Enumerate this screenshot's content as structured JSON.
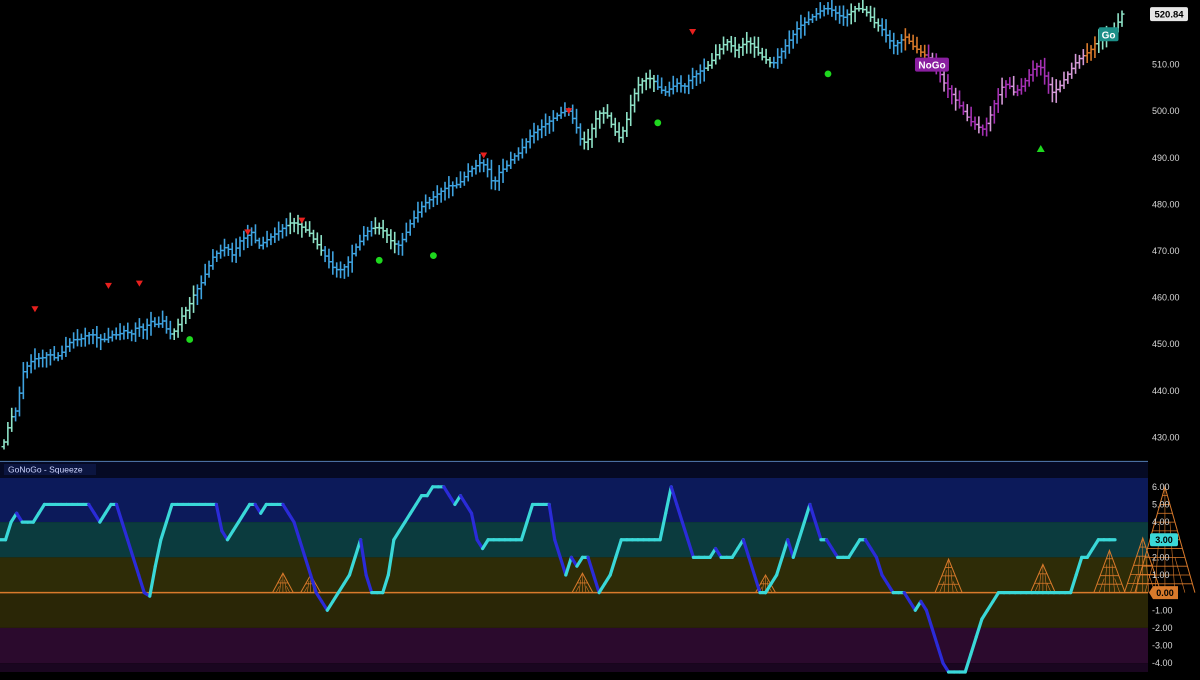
{
  "chart_data": [
    {
      "type": "ohlc",
      "title": "",
      "ylim": [
        426,
        523
      ],
      "yticks": [
        "430.00",
        "440.00",
        "450.00",
        "460.00",
        "470.00",
        "480.00",
        "490.00",
        "500.00",
        "510.00"
      ],
      "last_price_label": "520.84",
      "labels": {
        "nogo": "NoGo",
        "go": "Go"
      },
      "colors": {
        "strong_go": "#3fa3e0",
        "weak_go": "#8fe3c8",
        "nogo_weak": "#d59ad8",
        "nogo_strong": "#a531b4",
        "transition": "#d97a2b",
        "counter_down": "#e8201e",
        "go_dot": "#1ed81e",
        "nogo_badge": "#8a1fa0",
        "go_badge": "#1c8f88"
      },
      "price_series": [
        429,
        434,
        436,
        444,
        446,
        447,
        447,
        448,
        447,
        448,
        450,
        451,
        451,
        452,
        452,
        451,
        451,
        452,
        452,
        453,
        452,
        454,
        453,
        455,
        454,
        455,
        452,
        453,
        456,
        458,
        461,
        463,
        466,
        469,
        470,
        471,
        469,
        472,
        473,
        474,
        471,
        472,
        473,
        474,
        475,
        476,
        476,
        475,
        474,
        472,
        470,
        468,
        466,
        466,
        467,
        470,
        472,
        474,
        475,
        475,
        474,
        472,
        471,
        473,
        476,
        478,
        480,
        481,
        482,
        483,
        484,
        484,
        485,
        487,
        488,
        489,
        488,
        484,
        487,
        488,
        490,
        491,
        493,
        495,
        496,
        497,
        498,
        499,
        500,
        500,
        497,
        493,
        494,
        498,
        500,
        499,
        496,
        494,
        498,
        503,
        506,
        507,
        507,
        505,
        504,
        505,
        506,
        505,
        507,
        508,
        509,
        510,
        512,
        514,
        515,
        513,
        514,
        515,
        514,
        512,
        511,
        510,
        512,
        514,
        516,
        518,
        519,
        520,
        521,
        522,
        522,
        521,
        520,
        521,
        522,
        522,
        521,
        519,
        518,
        516,
        514,
        515,
        516,
        514,
        513,
        512,
        511,
        509,
        506,
        504,
        502,
        500,
        498,
        497,
        496,
        498,
        502,
        505,
        506,
        504,
        505,
        507,
        509,
        510,
        507,
        504,
        505,
        507,
        509,
        511,
        512,
        513,
        515,
        516,
        517,
        518,
        520.84
      ],
      "counter_trend_down": [
        {
          "i": 8,
          "v": 457.5
        },
        {
          "i": 27,
          "v": 462.5
        },
        {
          "i": 35,
          "v": 463
        },
        {
          "i": 63,
          "v": 474
        },
        {
          "i": 77,
          "v": 476.5
        },
        {
          "i": 124,
          "v": 490.5
        },
        {
          "i": 146,
          "v": 500
        },
        {
          "i": 178,
          "v": 517
        }
      ],
      "go_dots": [
        {
          "i": 48,
          "v": 451
        },
        {
          "i": 97,
          "v": 468
        },
        {
          "i": 111,
          "v": 469
        },
        {
          "i": 169,
          "v": 497.5
        },
        {
          "i": 213,
          "v": 508
        }
      ],
      "counter_trend_up": [
        {
          "i": 268,
          "v": 492
        }
      ]
    },
    {
      "type": "line",
      "title": "GoNoGo - Squeeze",
      "ylim": [
        -4.5,
        6.5
      ],
      "yticks": [
        "6.00",
        "5.00",
        "4.00",
        "3.00",
        "2.00",
        "1.00",
        "0.00",
        "-1.00",
        "-2.00",
        "-3.00",
        "-4.00"
      ],
      "current_value_label": "3.00",
      "zero_label": "0.00",
      "zones": [
        {
          "from": 4,
          "to": 6.5,
          "color": "#0c1a5a"
        },
        {
          "from": 2,
          "to": 4,
          "color": "#0b3b3e"
        },
        {
          "from": 0,
          "to": 2,
          "color": "#2e2c07"
        },
        {
          "from": -2,
          "to": 0,
          "color": "#2a2606"
        },
        {
          "from": -4,
          "to": -2,
          "color": "#2b0a2d"
        },
        {
          "from": -4.5,
          "to": -4,
          "color": "#1a0620"
        }
      ],
      "colors": {
        "positive": "#3ad8d8",
        "momentum": "#2b2bd8",
        "zero_line": "#d97a2b",
        "squeeze": "#d97a2b"
      },
      "oscillator": [
        3,
        3,
        4,
        4.5,
        4,
        4,
        4,
        4.5,
        5,
        5,
        5,
        5,
        5,
        5,
        5,
        5,
        5,
        4.5,
        4,
        4.5,
        5,
        5,
        4,
        3,
        2,
        1,
        0,
        -0.2,
        1.5,
        3,
        4,
        5,
        5,
        5,
        5,
        5,
        5,
        5,
        5,
        5,
        3.5,
        3,
        3.5,
        4,
        4.5,
        5,
        5,
        4.5,
        5,
        5,
        5,
        5,
        4.5,
        4,
        3,
        2,
        1,
        0,
        -0.5,
        -1,
        -0.5,
        0,
        0.5,
        1,
        2,
        3,
        1,
        0,
        0,
        0,
        1,
        3,
        3.5,
        4,
        4.5,
        5,
        5.5,
        5.5,
        6,
        6,
        6,
        5.5,
        5,
        5.5,
        5,
        4.5,
        3,
        2.5,
        3,
        3,
        3,
        3,
        3,
        3,
        3,
        4,
        5,
        5,
        5,
        5,
        3,
        2,
        1,
        2,
        1.5,
        2,
        2,
        1,
        0,
        0.5,
        1,
        2,
        3,
        3,
        3,
        3,
        3,
        3,
        3,
        3,
        4.5,
        6,
        5,
        4,
        3,
        2,
        2,
        2,
        2,
        2.5,
        2,
        2,
        2,
        2.5,
        3,
        2,
        1,
        0,
        0,
        0.5,
        1,
        2,
        3,
        2,
        3,
        4,
        5,
        4,
        3,
        3,
        2.5,
        2,
        2,
        2,
        2.5,
        3,
        3,
        2.5,
        2,
        1,
        0.5,
        0,
        0,
        0,
        -0.5,
        -1,
        -0.5,
        -1,
        -2,
        -3,
        -4,
        -4.5,
        -4.5,
        -4.5,
        -4.5,
        -3.5,
        -2.5,
        -1.5,
        -1,
        -0.5,
        0,
        0,
        0,
        0,
        0,
        0,
        0,
        0,
        0,
        0,
        0,
        0,
        0,
        0,
        1,
        2,
        2,
        2.5,
        3,
        3,
        3,
        3
      ],
      "squeeze_peaks": [
        {
          "i": 51,
          "h": 1.1
        },
        {
          "i": 56,
          "h": 1.0
        },
        {
          "i": 105,
          "h": 1.1
        },
        {
          "i": 138,
          "h": 1.0
        },
        {
          "i": 171,
          "h": 1.9
        },
        {
          "i": 188,
          "h": 1.6
        },
        {
          "i": 200,
          "h": 2.4
        },
        {
          "i": 206,
          "h": 3.1
        },
        {
          "i": 210,
          "h": 6.0
        }
      ]
    }
  ]
}
